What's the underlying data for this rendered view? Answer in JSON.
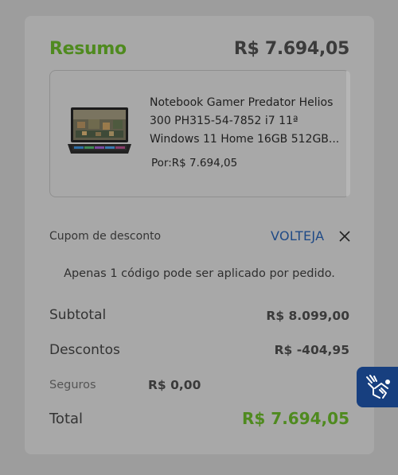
{
  "summary": {
    "title": "Resumo",
    "total": "R$ 7.694,05"
  },
  "product": {
    "image_icon": "laptop-image",
    "name": "Notebook Gamer Predator Helios 300 PH315-54-7852 i7 11ª Windows 11 Home 16GB 512GB...",
    "price": "Por:R$ 7.694,05"
  },
  "coupon": {
    "label": "Cupom de desconto",
    "code": "VOLTEJA",
    "remove_icon": "close-icon",
    "note": "Apenas 1 código pode ser aplicado por pedido."
  },
  "totals": {
    "subtotal_label": "Subtotal",
    "subtotal_value": "R$ 8.099,00",
    "discount_label": "Descontos",
    "discount_value": "R$ -404,95",
    "insurance_label": "Seguros",
    "insurance_value": "R$ 0,00",
    "total_label": "Total",
    "total_value": "R$ 7.694,05"
  },
  "accessibility": {
    "icon": "sign-language-icon"
  },
  "colors": {
    "accent_green": "#4f8a1f",
    "link_blue": "#1f4a86",
    "a11y_blue": "#173f7f"
  }
}
